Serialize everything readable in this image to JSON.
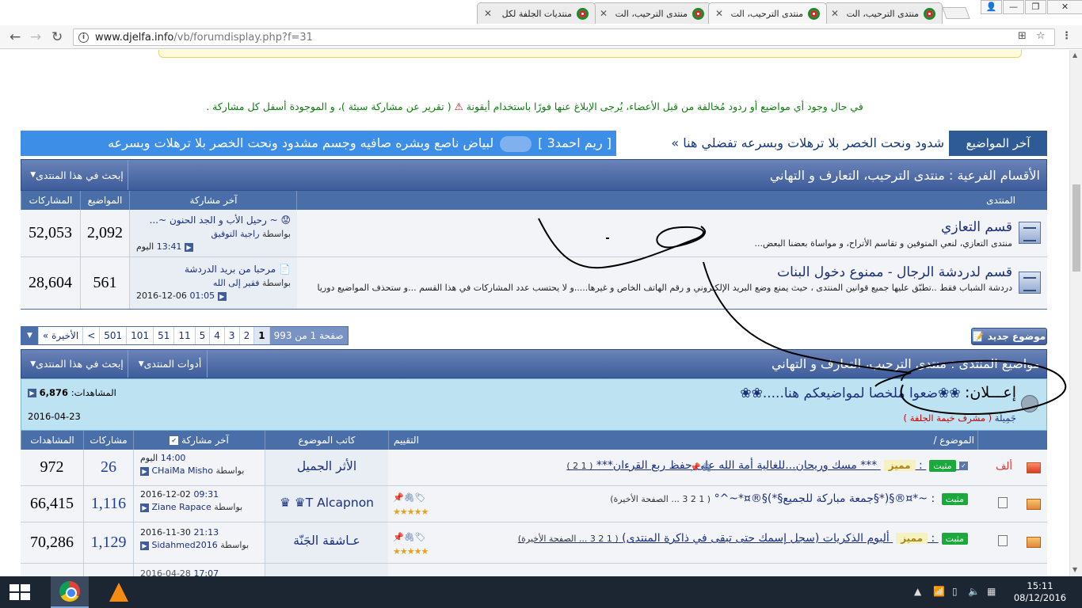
{
  "browser": {
    "tabs": [
      {
        "label": "منتدى الترحيب، الت",
        "active": false
      },
      {
        "label": "منتدى الترحيب، الت",
        "active": true
      },
      {
        "label": "منتدى الترحيب، الت",
        "active": false
      },
      {
        "label": "منتديات الجلفة لكل",
        "active": false
      }
    ],
    "url_host": "www.djelfa.info",
    "url_path": "/vb/forumdisplay.php?f=31"
  },
  "page": {
    "warning": "في حال وجود أي مواضيع أو ردود مُخالفة من قبل الأعضاء، يُرجى الإبلاغ عنها فورًا باستخدام أيقونة",
    "warning_tail": "( تقرير عن مشاركة سيئة )، و الموجودة أسفل كل مشاركة .",
    "marquee": {
      "label": "آخر المواضيع",
      "headline1": "شدود ونحت الخصر بلا ترهلات وبسرعه تفضلي هنا »",
      "poster": "[ ريم احمد3 ]",
      "headline2": "لبياض ناصع وبشره صافيه وجسم مشدود ونحت الخصر بلا ترهلات وبسرعه"
    },
    "subforums": {
      "title": "الأقسام الفرعية : منتدى الترحيب، التعارف و التهاني",
      "search_label": "إبحث في هذا المنتدى",
      "columns": {
        "forum": "المنتدى",
        "last_post": "آخر مشاركة",
        "threads": "المواضيع",
        "posts": "المشاركات"
      },
      "rows": [
        {
          "title": "قسم التعازي",
          "desc": "منتدى التعازي، لنعي المتوفين و تقاسم الأتراح، و مواساة بعضنا البعض...",
          "last_title": "~ رحيل الأب و الجد الحنون ~...",
          "last_by_prefix": "بواسطة",
          "last_by": "راجية التوفيق",
          "last_date": "اليوم",
          "last_time": "13:41",
          "threads": "2,092",
          "posts": "52,053"
        },
        {
          "title": "قسم لدردشة الرجال - ممنوع دخول البنات",
          "desc": "دردشة الشباب فقط ..تطبّق عليها جميع قوانين المنتدى ، حيث يمنع وضع البريد الإلكتروني و رقم الهاتف الخاص و غيرها.....و لا يحتسب عدد المشاركات في هذا القسم ...و ستحذف المواضيع دوريا",
          "last_title": "مرحبا من بريد الدردشة",
          "last_by_prefix": "بواسطة",
          "last_by": "فقير إلى الله",
          "last_date": "2016-12-06",
          "last_time": "01:05",
          "threads": "561",
          "posts": "28,604"
        }
      ]
    },
    "pager": {
      "info": "صفحة 1 من 993",
      "pages": [
        "1",
        "2",
        "3",
        "4",
        "5",
        "11",
        "51",
        "101",
        "501",
        ">",
        "الأخيرة »"
      ]
    },
    "new_thread_label": "موضوع جديد",
    "threads_block": {
      "title": "مواضيع المنتدى : منتدى الترحيب، التعارف و التهاني",
      "tools_label": "أدوات المنتدى",
      "search_label": "إبحث في هذا المنتدى"
    },
    "announcement": {
      "prefix": "إعـــلان:",
      "title": "❀❀ضعوا ملخصا لمواضيعكم هنا.....❀❀",
      "by": "جَمِيلَة",
      "role": "( مشرف خيمة الجلفة )",
      "views_label": "المشاهدات:",
      "views": "6,876",
      "date": "2016-04-23"
    },
    "thread_columns": {
      "rating": "التقييم",
      "topic": "الموضوع /",
      "author": "كاتب الموضوع",
      "last_post": "آخر مشاركة",
      "replies": "مشاركات",
      "views": "المشاهدات"
    },
    "threads": [
      {
        "sticky_label": "مثبت",
        "featured": "مميز",
        "title": "*** مسك وريحان...للغالية أمة الله على حفظ ربع القرءان***",
        "pages": "( 1 2 )",
        "author": "الأثر الجميل",
        "last_date": "اليوم",
        "last_time": "14:00",
        "last_by_prefix": "بواسطة",
        "last_by": "CHaiMa Misho",
        "replies": "26",
        "views": "972",
        "prefix_tag": "ألف"
      },
      {
        "sticky_label": "مثبت",
        "title": "~*¤®§(*§جمعة مباركة للجميع§*)§®¤*~^°",
        "pages": "( 1 2 3 ... الصفحة الأخيرة)",
        "author": "T Alcapnon♛ ♛",
        "last_date": "2016-12-02",
        "last_time": "09:31",
        "last_by_prefix": "بواسطة",
        "last_by": "Ziane Rapace",
        "replies": "1,116",
        "views": "66,415",
        "stars": "★★★★★"
      },
      {
        "sticky_label": "مثبت",
        "featured": "مميز",
        "title": "ألبوم الذكريات (سجل إسمك حتى تبقى في ذاكرة المنتدى)",
        "pages": "( 1 2 3 ... الصفحة الأخيرة)",
        "author": "عـاشقة الجَنّة",
        "last_date": "2016-11-30",
        "last_time": "21:13",
        "last_by_prefix": "بواسطة",
        "last_by": "Sidahmed2016",
        "replies": "1,129",
        "views": "70,286",
        "stars": "★★★★★"
      },
      {
        "last_date": "2016-04-28",
        "last_time": "17:07"
      }
    ]
  },
  "taskbar": {
    "time": "15:11",
    "date": "08/12/2016"
  }
}
